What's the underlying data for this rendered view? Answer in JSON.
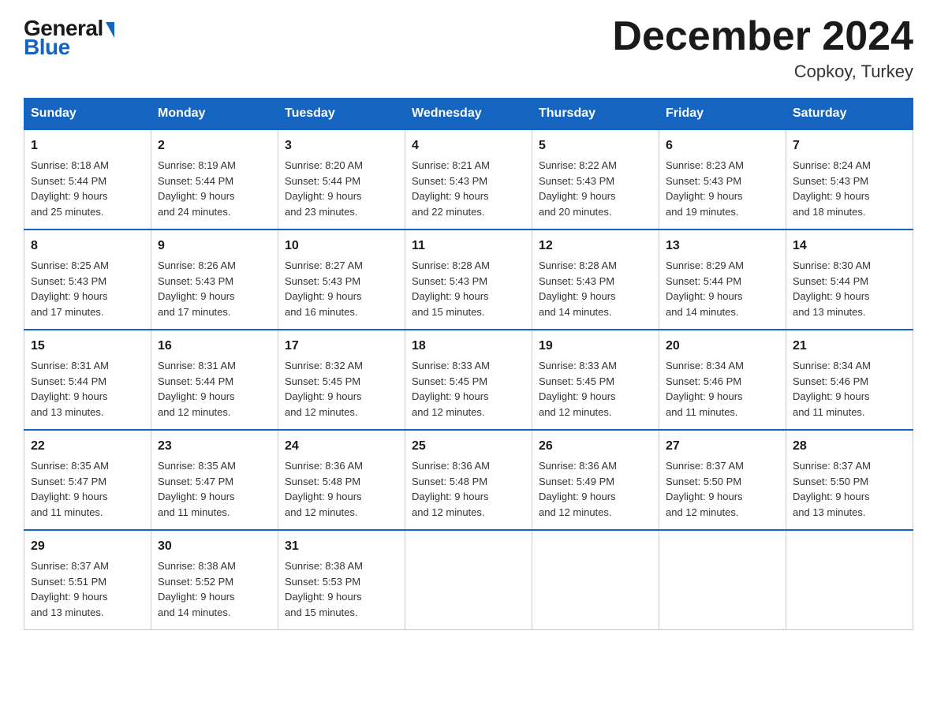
{
  "logo": {
    "general": "General",
    "blue": "Blue"
  },
  "title": "December 2024",
  "location": "Copkoy, Turkey",
  "days_header": [
    "Sunday",
    "Monday",
    "Tuesday",
    "Wednesday",
    "Thursday",
    "Friday",
    "Saturday"
  ],
  "weeks": [
    [
      {
        "day": "1",
        "sunrise": "8:18 AM",
        "sunset": "5:44 PM",
        "daylight": "9 hours and 25 minutes."
      },
      {
        "day": "2",
        "sunrise": "8:19 AM",
        "sunset": "5:44 PM",
        "daylight": "9 hours and 24 minutes."
      },
      {
        "day": "3",
        "sunrise": "8:20 AM",
        "sunset": "5:44 PM",
        "daylight": "9 hours and 23 minutes."
      },
      {
        "day": "4",
        "sunrise": "8:21 AM",
        "sunset": "5:43 PM",
        "daylight": "9 hours and 22 minutes."
      },
      {
        "day": "5",
        "sunrise": "8:22 AM",
        "sunset": "5:43 PM",
        "daylight": "9 hours and 20 minutes."
      },
      {
        "day": "6",
        "sunrise": "8:23 AM",
        "sunset": "5:43 PM",
        "daylight": "9 hours and 19 minutes."
      },
      {
        "day": "7",
        "sunrise": "8:24 AM",
        "sunset": "5:43 PM",
        "daylight": "9 hours and 18 minutes."
      }
    ],
    [
      {
        "day": "8",
        "sunrise": "8:25 AM",
        "sunset": "5:43 PM",
        "daylight": "9 hours and 17 minutes."
      },
      {
        "day": "9",
        "sunrise": "8:26 AM",
        "sunset": "5:43 PM",
        "daylight": "9 hours and 17 minutes."
      },
      {
        "day": "10",
        "sunrise": "8:27 AM",
        "sunset": "5:43 PM",
        "daylight": "9 hours and 16 minutes."
      },
      {
        "day": "11",
        "sunrise": "8:28 AM",
        "sunset": "5:43 PM",
        "daylight": "9 hours and 15 minutes."
      },
      {
        "day": "12",
        "sunrise": "8:28 AM",
        "sunset": "5:43 PM",
        "daylight": "9 hours and 14 minutes."
      },
      {
        "day": "13",
        "sunrise": "8:29 AM",
        "sunset": "5:44 PM",
        "daylight": "9 hours and 14 minutes."
      },
      {
        "day": "14",
        "sunrise": "8:30 AM",
        "sunset": "5:44 PM",
        "daylight": "9 hours and 13 minutes."
      }
    ],
    [
      {
        "day": "15",
        "sunrise": "8:31 AM",
        "sunset": "5:44 PM",
        "daylight": "9 hours and 13 minutes."
      },
      {
        "day": "16",
        "sunrise": "8:31 AM",
        "sunset": "5:44 PM",
        "daylight": "9 hours and 12 minutes."
      },
      {
        "day": "17",
        "sunrise": "8:32 AM",
        "sunset": "5:45 PM",
        "daylight": "9 hours and 12 minutes."
      },
      {
        "day": "18",
        "sunrise": "8:33 AM",
        "sunset": "5:45 PM",
        "daylight": "9 hours and 12 minutes."
      },
      {
        "day": "19",
        "sunrise": "8:33 AM",
        "sunset": "5:45 PM",
        "daylight": "9 hours and 12 minutes."
      },
      {
        "day": "20",
        "sunrise": "8:34 AM",
        "sunset": "5:46 PM",
        "daylight": "9 hours and 11 minutes."
      },
      {
        "day": "21",
        "sunrise": "8:34 AM",
        "sunset": "5:46 PM",
        "daylight": "9 hours and 11 minutes."
      }
    ],
    [
      {
        "day": "22",
        "sunrise": "8:35 AM",
        "sunset": "5:47 PM",
        "daylight": "9 hours and 11 minutes."
      },
      {
        "day": "23",
        "sunrise": "8:35 AM",
        "sunset": "5:47 PM",
        "daylight": "9 hours and 11 minutes."
      },
      {
        "day": "24",
        "sunrise": "8:36 AM",
        "sunset": "5:48 PM",
        "daylight": "9 hours and 12 minutes."
      },
      {
        "day": "25",
        "sunrise": "8:36 AM",
        "sunset": "5:48 PM",
        "daylight": "9 hours and 12 minutes."
      },
      {
        "day": "26",
        "sunrise": "8:36 AM",
        "sunset": "5:49 PM",
        "daylight": "9 hours and 12 minutes."
      },
      {
        "day": "27",
        "sunrise": "8:37 AM",
        "sunset": "5:50 PM",
        "daylight": "9 hours and 12 minutes."
      },
      {
        "day": "28",
        "sunrise": "8:37 AM",
        "sunset": "5:50 PM",
        "daylight": "9 hours and 13 minutes."
      }
    ],
    [
      {
        "day": "29",
        "sunrise": "8:37 AM",
        "sunset": "5:51 PM",
        "daylight": "9 hours and 13 minutes."
      },
      {
        "day": "30",
        "sunrise": "8:38 AM",
        "sunset": "5:52 PM",
        "daylight": "9 hours and 14 minutes."
      },
      {
        "day": "31",
        "sunrise": "8:38 AM",
        "sunset": "5:53 PM",
        "daylight": "9 hours and 15 minutes."
      },
      null,
      null,
      null,
      null
    ]
  ],
  "labels": {
    "sunrise": "Sunrise:",
    "sunset": "Sunset:",
    "daylight": "Daylight:"
  }
}
